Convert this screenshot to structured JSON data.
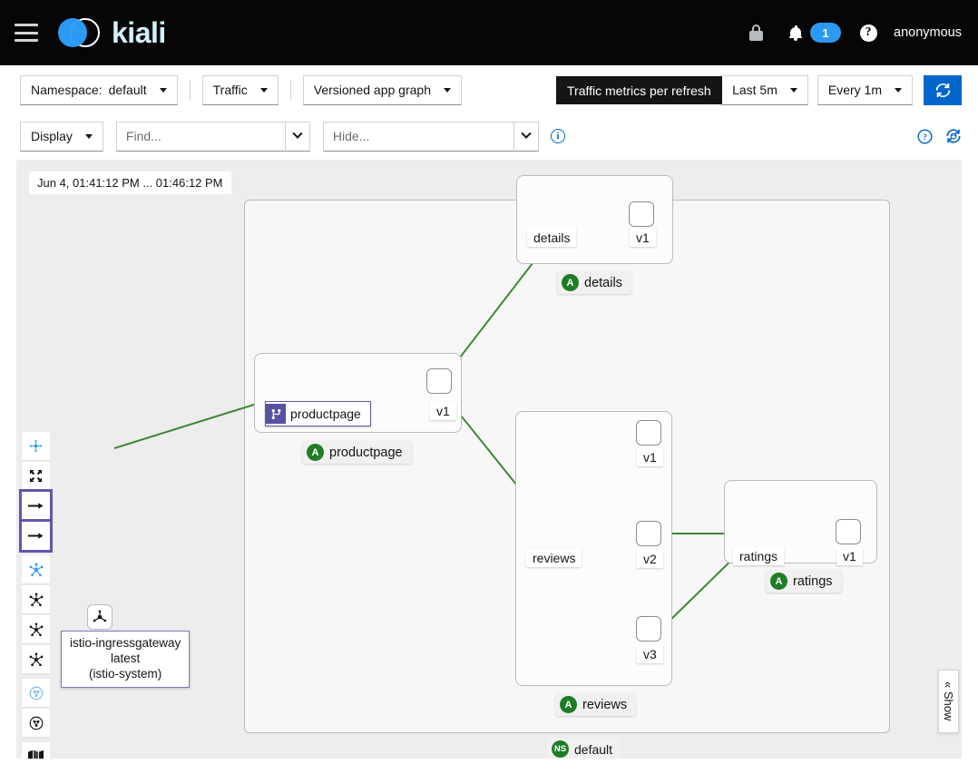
{
  "masthead": {
    "menu_icon": "hamburger-icon",
    "brand": "kiali",
    "lock_icon": "lock-icon",
    "bell_icon": "bell-icon",
    "notification_count": "1",
    "help_icon": "question-circle-icon",
    "username": "anonymous"
  },
  "toolbar_primary": {
    "namespace_label": "Namespace:",
    "namespace_value": "default",
    "traffic_label": "Traffic",
    "graph_type": "Versioned app graph",
    "metrics_info_icon": "info-circle-icon",
    "duration": "Last 5m",
    "refresh_interval": "Every 1m",
    "refresh_button_icon": "refresh-icon"
  },
  "tooltip": {
    "text": "Traffic metrics per refresh"
  },
  "toolbar_secondary": {
    "display_label": "Display",
    "find_placeholder": "Find...",
    "find_value": "",
    "hide_placeholder": "Hide...",
    "hide_value": "",
    "info_icon": "info-circle-icon",
    "help_icon": "help-circle-icon",
    "legend_icon": "graph-legend-icon"
  },
  "graph": {
    "timestamp": "Jun 4, 01:41:12 PM ... 01:46:12 PM",
    "namespace_badge": {
      "abbr": "NS",
      "label": "default"
    },
    "edge_color": "#3e8635",
    "groups": [
      {
        "name": "details",
        "abbr": "A",
        "label": "details",
        "service": "details",
        "versions": [
          "v1"
        ]
      },
      {
        "name": "productpage",
        "abbr": "A",
        "label": "productpage",
        "service": "productpage",
        "versions": [
          "v1"
        ],
        "has_virtual_service": true
      },
      {
        "name": "reviews",
        "abbr": "A",
        "label": "reviews",
        "service": "reviews",
        "versions": [
          "v1",
          "v2",
          "v3"
        ]
      },
      {
        "name": "ratings",
        "abbr": "A",
        "label": "ratings",
        "service": "ratings",
        "versions": [
          "v1"
        ]
      }
    ],
    "ingress": {
      "icon": "istio-gateway-icon",
      "tooltip_line1": "istio-ingressgateway",
      "tooltip_line2": "latest",
      "tooltip_line3": "(istio-system)"
    },
    "side_toolbar": [
      {
        "icon": "drag-move-icon",
        "active": true
      },
      {
        "icon": "fit-screen-icon",
        "active": false
      },
      {
        "icon": "arrow-right-icon",
        "active": false,
        "highlighted": true
      },
      {
        "icon": "arrow-right-icon",
        "active": false
      },
      {
        "icon": "layout-dagre-icon",
        "active": true
      },
      {
        "icon": "layout-grid-icon",
        "active": false
      },
      {
        "icon": "layout-cola-icon",
        "active": false
      },
      {
        "icon": "layout-concentric-icon",
        "active": false
      },
      {
        "icon": "namespace-layout-icon",
        "active": true
      },
      {
        "icon": "namespace-box-icon",
        "active": false
      },
      {
        "icon": "legend-map-icon",
        "active": false
      }
    ],
    "show_tab_label": "Show",
    "show_tab_icon": "double-chevron-left-icon"
  }
}
